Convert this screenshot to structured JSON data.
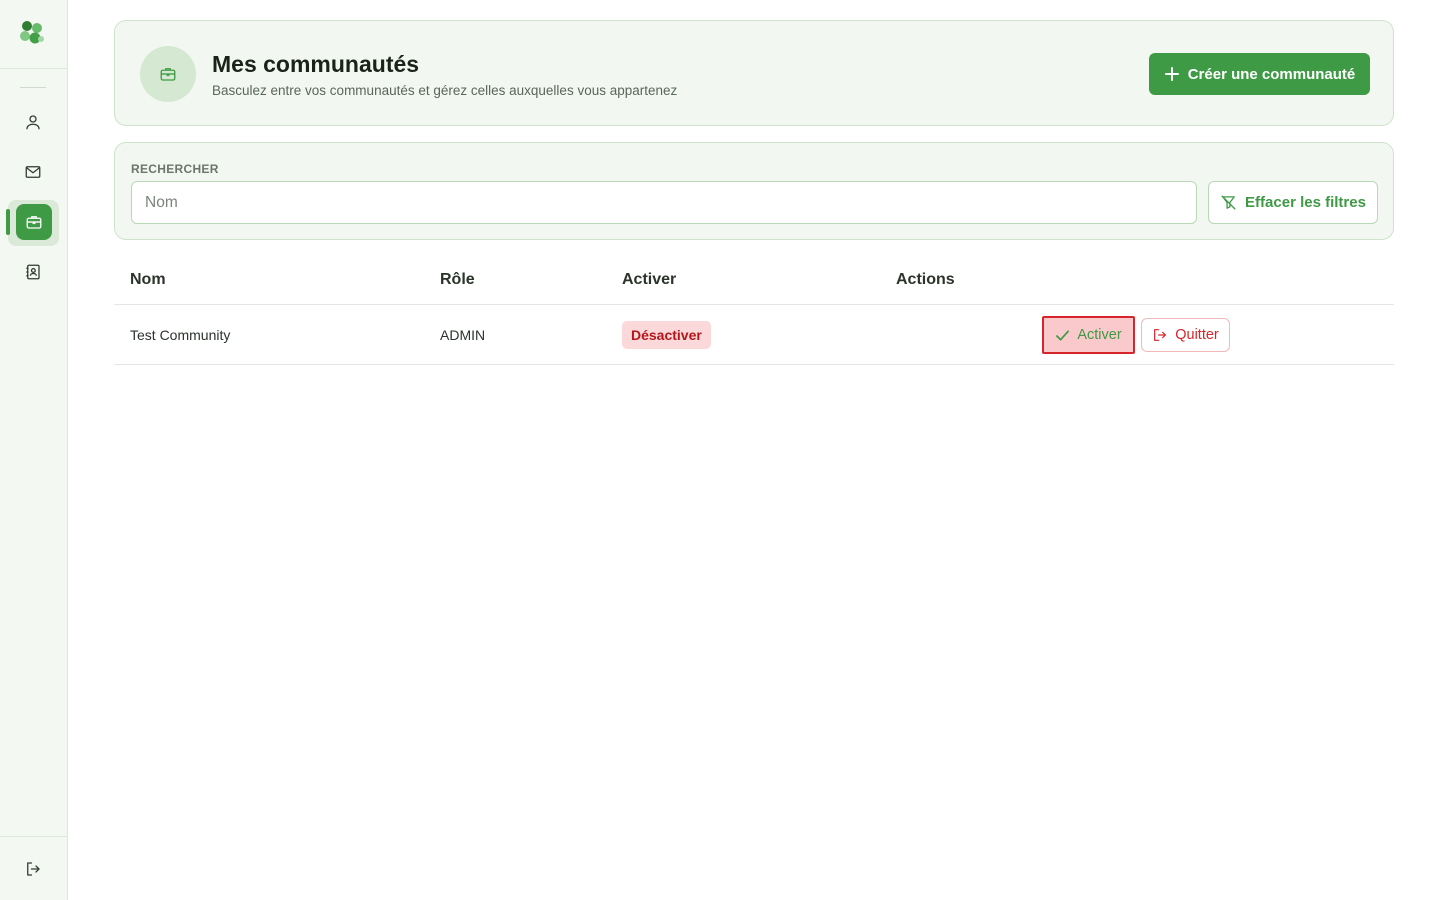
{
  "sidebar": {
    "logo_icon": "clover-logo",
    "items": [
      {
        "icon": "user-icon"
      },
      {
        "icon": "mail-icon"
      },
      {
        "icon": "briefcase-icon",
        "active": true
      },
      {
        "icon": "contact-book-icon"
      }
    ],
    "logout_icon": "logout-icon"
  },
  "header": {
    "title": "Mes communautés",
    "subtitle": "Basculez entre vos communautés et gérez celles auxquelles vous appartenez",
    "create_button": "Créer une communauté"
  },
  "search": {
    "label": "RECHERCHER",
    "placeholder": "Nom",
    "value": "",
    "clear_button": "Effacer les filtres"
  },
  "table": {
    "columns": [
      "Nom",
      "Rôle",
      "Activer",
      "Actions"
    ],
    "rows": [
      {
        "name": "Test Community",
        "role": "ADMIN",
        "status": "Désactiver",
        "activate_label": "Activer",
        "quit_label": "Quitter"
      }
    ]
  },
  "colors": {
    "accent": "#3f9a45",
    "danger": "#d6262b",
    "card_bg": "#f2f8f1"
  }
}
